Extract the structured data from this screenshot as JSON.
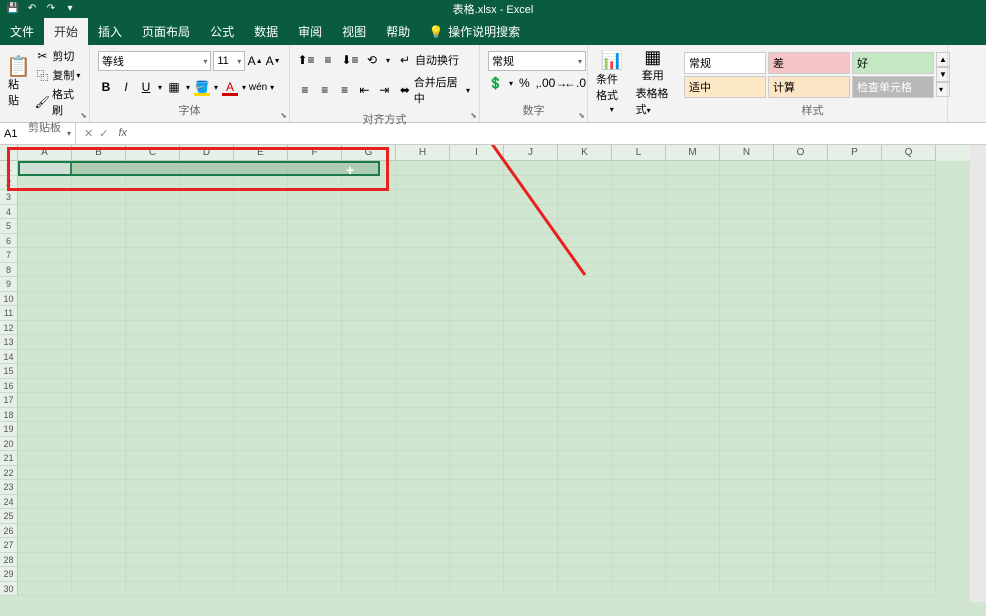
{
  "title": "表格.xlsx - Excel",
  "tabs": {
    "file": "文件",
    "home": "开始",
    "insert": "插入",
    "layout": "页面布局",
    "formulas": "公式",
    "data": "数据",
    "review": "审阅",
    "view": "视图",
    "help": "帮助",
    "tellme": "操作说明搜索"
  },
  "clipboard": {
    "paste": "粘贴",
    "cut": "剪切",
    "copy": "复制",
    "painter": "格式刷",
    "label": "剪贴板"
  },
  "font": {
    "name": "等线",
    "size": "11",
    "label": "字体",
    "bold": "B",
    "italic": "I",
    "underline": "U"
  },
  "alignment": {
    "wrap": "自动换行",
    "merge": "合并后居中",
    "label": "对齐方式"
  },
  "number": {
    "format": "常规",
    "label": "数字",
    "percent": "%",
    "comma": ","
  },
  "condfmt": "条件格式",
  "tablefmt": {
    "l1": "套用",
    "l2": "表格格式"
  },
  "styles": {
    "normal": "常规",
    "bad": "差",
    "good": "好",
    "neutral": "适中",
    "calc": "计算",
    "check": "检查单元格",
    "label": "样式"
  },
  "namebox": "A1",
  "columns": [
    "A",
    "B",
    "C",
    "D",
    "E",
    "F",
    "G",
    "H",
    "I",
    "J",
    "K",
    "L",
    "M",
    "N",
    "O",
    "P",
    "Q"
  ],
  "rowCount": 30
}
